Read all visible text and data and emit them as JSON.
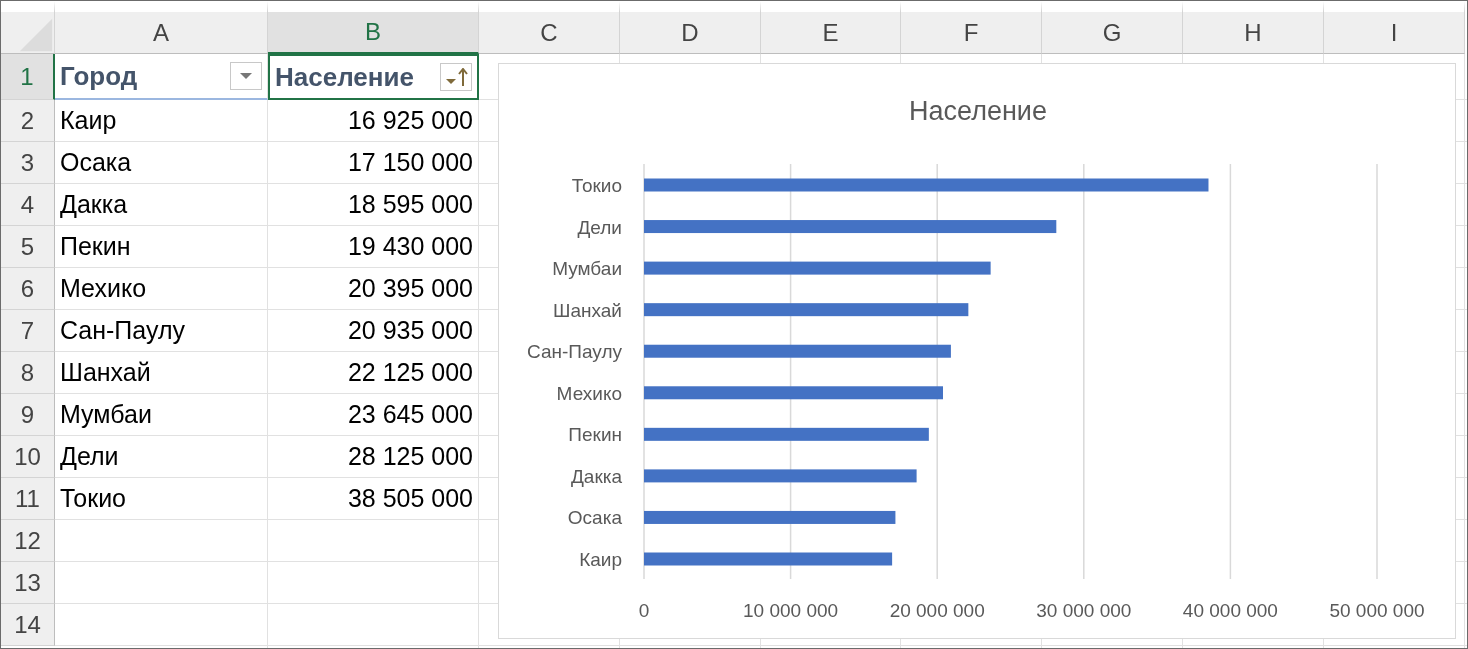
{
  "column_headers": [
    {
      "label": "A",
      "selected": false
    },
    {
      "label": "B",
      "selected": true
    },
    {
      "label": "C",
      "selected": false
    },
    {
      "label": "D",
      "selected": false
    },
    {
      "label": "E",
      "selected": false
    },
    {
      "label": "F",
      "selected": false
    },
    {
      "label": "G",
      "selected": false
    },
    {
      "label": "H",
      "selected": false
    },
    {
      "label": "I",
      "selected": false
    }
  ],
  "row_headers": [
    {
      "label": "1",
      "selected": true
    },
    {
      "label": "2",
      "selected": false
    },
    {
      "label": "3",
      "selected": false
    },
    {
      "label": "4",
      "selected": false
    },
    {
      "label": "5",
      "selected": false
    },
    {
      "label": "6",
      "selected": false
    },
    {
      "label": "7",
      "selected": false
    },
    {
      "label": "8",
      "selected": false
    },
    {
      "label": "9",
      "selected": false
    },
    {
      "label": "10",
      "selected": false
    },
    {
      "label": "11",
      "selected": false
    },
    {
      "label": "12",
      "selected": false
    },
    {
      "label": "13",
      "selected": false
    },
    {
      "label": "14",
      "selected": false
    }
  ],
  "table": {
    "columns": [
      {
        "label": "Город",
        "sorted": false,
        "selected": false
      },
      {
        "label": "Население",
        "sorted": true,
        "selected": true
      }
    ],
    "rows": [
      [
        "Каир",
        "16 925 000"
      ],
      [
        "Осака",
        "17 150 000"
      ],
      [
        "Дакка",
        "18 595 000"
      ],
      [
        "Пекин",
        "19 430 000"
      ],
      [
        "Мехико",
        "20 395 000"
      ],
      [
        "Сан-Паулу",
        "20 935 000"
      ],
      [
        "Шанхай",
        "22 125 000"
      ],
      [
        "Мумбаи",
        "23 645 000"
      ],
      [
        "Дели",
        "28 125 000"
      ],
      [
        "Токио",
        "38 505 000"
      ]
    ]
  },
  "chart": {
    "chart_data": {
      "type": "bar",
      "orientation": "horizontal",
      "title": "Население",
      "grid": true,
      "categories": [
        "Токио",
        "Дели",
        "Мумбаи",
        "Шанхай",
        "Сан-Паулу",
        "Мехико",
        "Пекин",
        "Дакка",
        "Осака",
        "Каир"
      ],
      "series": [
        {
          "color": "#4472c4",
          "values": [
            38505000,
            28125000,
            23645000,
            22125000,
            20935000,
            20395000,
            19430000,
            18595000,
            17150000,
            16925000
          ]
        }
      ],
      "xlim": [
        0,
        50000000
      ],
      "xticks": [
        {
          "value": 0,
          "label": "0"
        },
        {
          "value": 10000000,
          "label": "10 000 000"
        },
        {
          "value": 20000000,
          "label": "20 000 000"
        },
        {
          "value": 30000000,
          "label": "30 000 000"
        },
        {
          "value": 40000000,
          "label": "40 000 000"
        },
        {
          "value": 50000000,
          "label": "50 000 000"
        }
      ]
    }
  }
}
